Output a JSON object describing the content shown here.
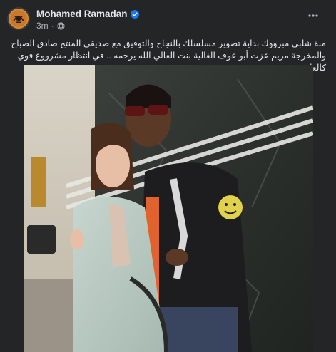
{
  "post": {
    "author_name": "Mohamed Ramadan",
    "timestamp": "3m",
    "caption_line1": "منة شلبي مبرووك بداية تصوير مسلسلك بالنجاح والتوفيق مع صديقي المنتج صادق الصباح",
    "caption_line2": "والمخرجة مريم عزت أبو عوف الغالية بنت الغالي الله يرحمه .. في انتظار مشرووع قوي كالعادة"
  },
  "icons": {
    "verified": "verified-badge-icon",
    "audience": "globe-icon",
    "more": "more-options-icon"
  },
  "colors": {
    "background": "#242526",
    "text_primary": "#e4e6eb",
    "text_secondary": "#b0b3b8",
    "verified_blue": "#1877f2"
  }
}
